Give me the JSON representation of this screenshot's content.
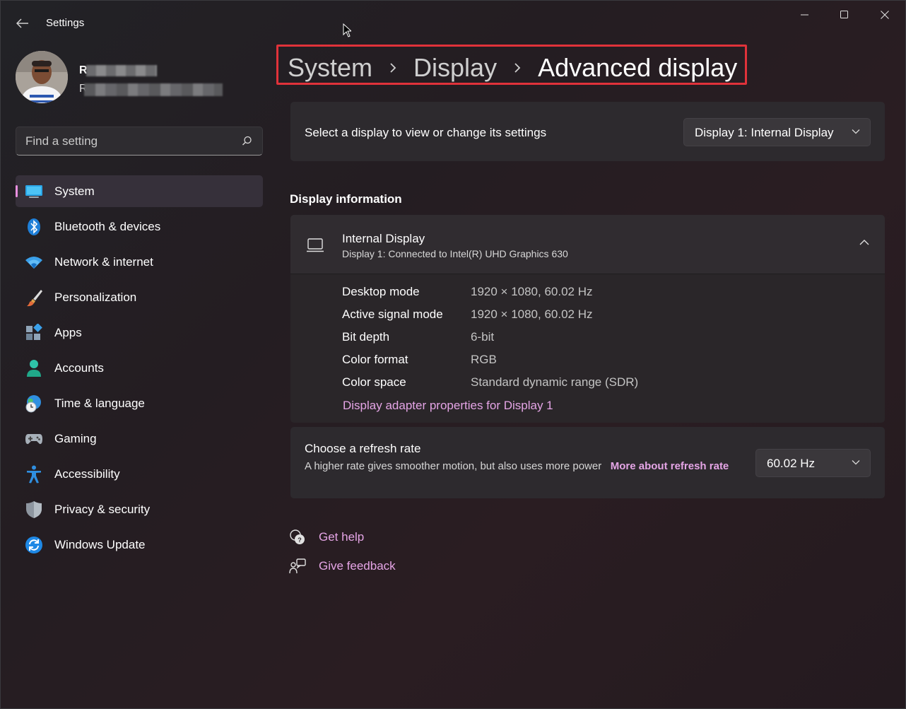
{
  "window": {
    "title": "Settings",
    "controls": [
      "minimize",
      "maximize",
      "close"
    ]
  },
  "profile": {
    "name_initial": "R",
    "email_initial": "R"
  },
  "search": {
    "placeholder": "Find a setting"
  },
  "sidebar": {
    "items": [
      {
        "label": "System",
        "icon": "system-display-icon",
        "active": true
      },
      {
        "label": "Bluetooth & devices",
        "icon": "bluetooth-icon"
      },
      {
        "label": "Network & internet",
        "icon": "wifi-icon"
      },
      {
        "label": "Personalization",
        "icon": "paintbrush-icon"
      },
      {
        "label": "Apps",
        "icon": "apps-icon"
      },
      {
        "label": "Accounts",
        "icon": "person-icon"
      },
      {
        "label": "Time & language",
        "icon": "globe-clock-icon"
      },
      {
        "label": "Gaming",
        "icon": "gamepad-icon"
      },
      {
        "label": "Accessibility",
        "icon": "accessibility-icon"
      },
      {
        "label": "Privacy & security",
        "icon": "shield-icon"
      },
      {
        "label": "Windows Update",
        "icon": "update-icon"
      }
    ]
  },
  "breadcrumb": {
    "items": [
      "System",
      "Display",
      "Advanced display"
    ],
    "highlight_color": "#e0323a"
  },
  "display_select": {
    "label": "Select a display to view or change its settings",
    "selected": "Display 1: Internal Display"
  },
  "display_info": {
    "section_title": "Display information",
    "title": "Internal Display",
    "subtitle": "Display 1: Connected to Intel(R) UHD Graphics 630",
    "rows": [
      {
        "label": "Desktop mode",
        "value": "1920 × 1080, 60.02 Hz"
      },
      {
        "label": "Active signal mode",
        "value": "1920 × 1080, 60.02 Hz"
      },
      {
        "label": "Bit depth",
        "value": "6-bit"
      },
      {
        "label": "Color format",
        "value": "RGB"
      },
      {
        "label": "Color space",
        "value": "Standard dynamic range (SDR)"
      }
    ],
    "adapter_link": "Display adapter properties for Display 1"
  },
  "refresh": {
    "title": "Choose a refresh rate",
    "description": "A higher rate gives smoother motion, but also uses more power",
    "link": "More about refresh rate",
    "selected": "60.02 Hz"
  },
  "help": {
    "get_help": "Get help",
    "give_feedback": "Give feedback"
  },
  "colors": {
    "accent": "#e5a5e6",
    "active_indicator": "#e88fdf",
    "background": "#241d22"
  }
}
